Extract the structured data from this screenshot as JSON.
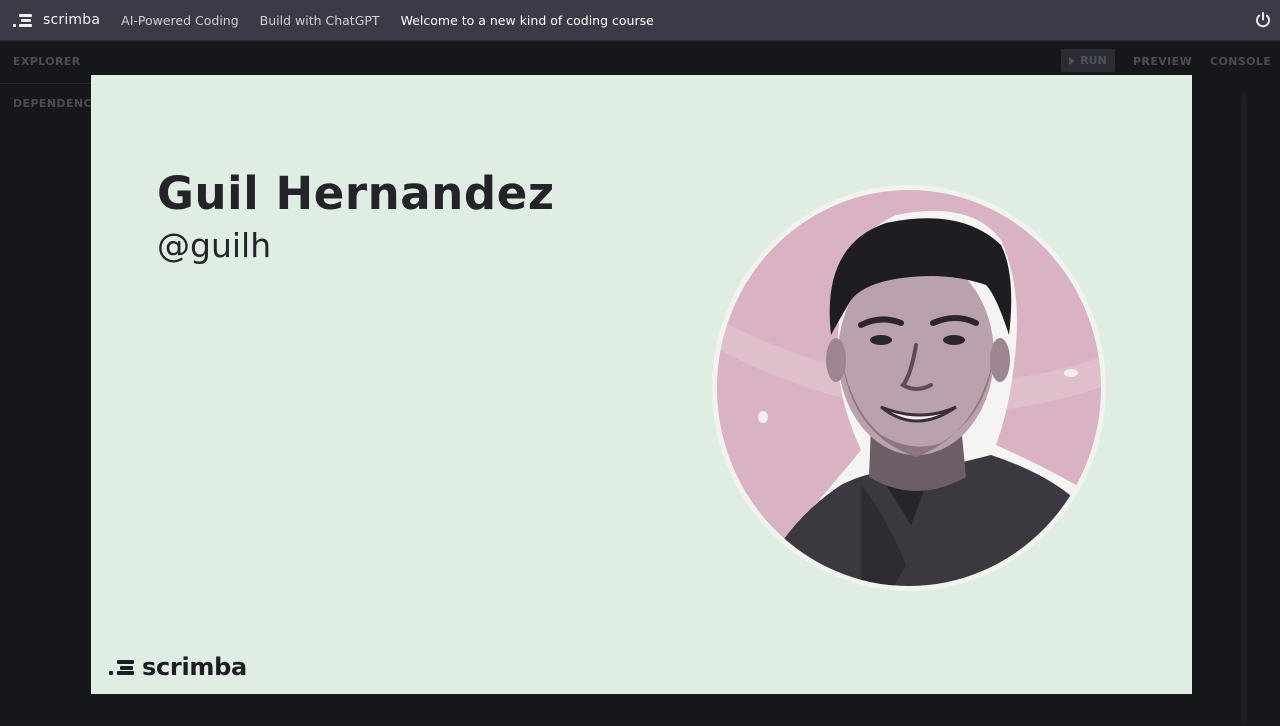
{
  "app": {
    "brand": "scrimba"
  },
  "breadcrumbs": [
    "AI-Powered Coding",
    "Build with ChatGPT",
    "Welcome to a new kind of coding course"
  ],
  "sidebar": {
    "explorer_label": "EXPLORER",
    "dependencies_label": "DEPENDENC"
  },
  "toolbar": {
    "run_label": "RUN",
    "preview_label": "PREVIEW",
    "console_label": "CONSOLE"
  },
  "slide": {
    "name": "Guil Hernandez",
    "handle": "@guilh",
    "logo_text": "scrimba"
  },
  "colors": {
    "topbar": "#3a3b46",
    "workspace": "#16171b",
    "slide_background": "#e0ede3",
    "portrait_tint": "#d9b2c4",
    "text_dark": "#232329"
  },
  "icons": {
    "brand": "scrimba-logo-icon",
    "power": "power-icon",
    "run": "play-icon"
  }
}
